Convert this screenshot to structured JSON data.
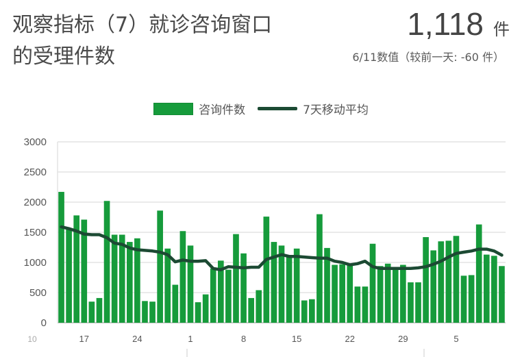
{
  "title": "观察指标（7）就诊咨询窗口的受理件数",
  "headline": {
    "value": "1,118",
    "unit": "件",
    "sub": "6/11数值（较前一天: -60 件）"
  },
  "colors": {
    "bar": "#169b3b",
    "line": "#1c4a33",
    "grid": "#e3e3e3",
    "axis": "#bbbbbb"
  },
  "chart_data": {
    "type": "bar",
    "series": [
      {
        "name": "咨询件数",
        "type": "bar",
        "values": [
          2170,
          1560,
          1780,
          1710,
          350,
          410,
          2020,
          1460,
          1460,
          1340,
          1400,
          360,
          350,
          1860,
          1230,
          630,
          1520,
          1280,
          340,
          470,
          900,
          1030,
          880,
          1470,
          1150,
          410,
          540,
          1760,
          1340,
          1280,
          1100,
          1230,
          370,
          390,
          1800,
          1240,
          960,
          970,
          960,
          600,
          600,
          1310,
          940,
          980,
          900,
          960,
          670,
          670,
          1420,
          1200,
          1350,
          1360,
          1440,
          780,
          790,
          1630,
          1130,
          1110,
          940
        ]
      },
      {
        "name": "7天移动平均",
        "type": "line",
        "values": [
          1590,
          1560,
          1520,
          1470,
          1460,
          1460,
          1410,
          1320,
          1300,
          1240,
          1210,
          1200,
          1190,
          1170,
          1130,
          1010,
          1040,
          1020,
          1020,
          1030,
          900,
          880,
          930,
          920,
          910,
          920,
          920,
          1050,
          1090,
          1130,
          1100,
          1100,
          1090,
          1080,
          1070,
          1070,
          1020,
          1000,
          960,
          980,
          1020,
          930,
          900,
          900,
          900,
          900,
          900,
          910,
          930,
          970,
          1020,
          1090,
          1150,
          1170,
          1190,
          1220,
          1220,
          1190,
          1120
        ]
      }
    ],
    "xticks": [
      {
        "label": "10",
        "index": -4,
        "faint": true
      },
      {
        "label": "17",
        "index": 3
      },
      {
        "label": "24",
        "index": 10
      },
      {
        "label": "1",
        "index": 17
      },
      {
        "label": "8",
        "index": 24
      },
      {
        "label": "15",
        "index": 31
      },
      {
        "label": "22",
        "index": 38
      },
      {
        "label": "29",
        "index": 45
      },
      {
        "label": "5",
        "index": 52
      }
    ],
    "yticks": [
      0,
      500,
      1000,
      1500,
      2000,
      2500,
      3000
    ],
    "ylim": [
      0,
      3000
    ],
    "grid": true,
    "legend_position": "top-center"
  }
}
